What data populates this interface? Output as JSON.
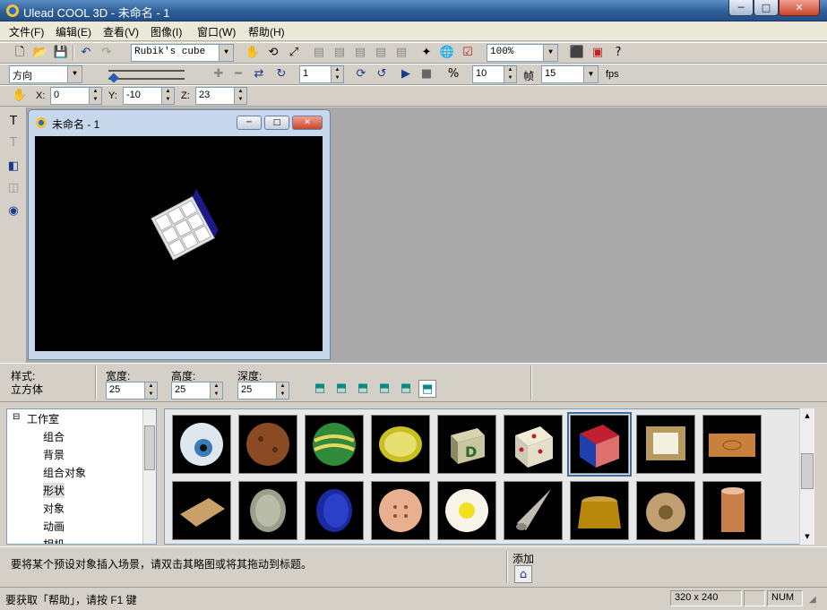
{
  "app": {
    "title": "Ulead COOL 3D - 未命名 - 1",
    "window_buttons": {
      "minimize": "─",
      "maximize": "□",
      "close": "✕"
    }
  },
  "menu": [
    "文件(F)",
    "编辑(E)",
    "查看(V)",
    "图像(I)",
    "窗口(W)",
    "帮助(H)"
  ],
  "toolbar1": {
    "object_select": "Rubik's cube",
    "zoom": "100%"
  },
  "toolbar2": {
    "mode": "方向",
    "frame": "1",
    "frame_count": "10",
    "frame_label": "帧",
    "fps_value": "15",
    "fps_label": "fps"
  },
  "toolbar3": {
    "x_label": "X:",
    "x_value": "0",
    "y_label": "Y:",
    "y_value": "-10",
    "z_label": "Z:",
    "z_value": "23"
  },
  "child_window": {
    "title": "未命名 - 1"
  },
  "properties": {
    "style_label": "样式:",
    "style_value": "立方体",
    "width_label": "宽度:",
    "width_value": "25",
    "height_label": "高度:",
    "height_value": "25",
    "depth_label": "深度:",
    "depth_value": "25"
  },
  "tree": {
    "root": "工作室",
    "items": [
      "组合",
      "背景",
      "组合对象",
      "形状",
      "对象",
      "动画",
      "相机"
    ],
    "selected_index": 3
  },
  "gallery": {
    "row1": [
      "eyeball",
      "cookie",
      "striped-ball",
      "lemon-slice",
      "letter-block",
      "dice",
      "rubiks-cube",
      "picture-frame",
      "wood-plank"
    ],
    "row2": [
      "cork-tile",
      "coin",
      "blue-disc",
      "button",
      "egg",
      "cone",
      "pot",
      "lock",
      "spool"
    ],
    "letter_block_text": "D",
    "selected": "rubiks-cube"
  },
  "hint": {
    "text": "要将某个预设对象插入场景，请双击其略图或将其拖动到标题。",
    "add_label": "添加"
  },
  "status": {
    "help_text": "要获取「帮助」，请按 F1 键",
    "dimensions": "320 x 240",
    "num": "NUM"
  },
  "colors": {
    "accent": "#3a6ea5",
    "canvas_bg": "#000000",
    "workspace_bg": "#a9a9a9"
  }
}
